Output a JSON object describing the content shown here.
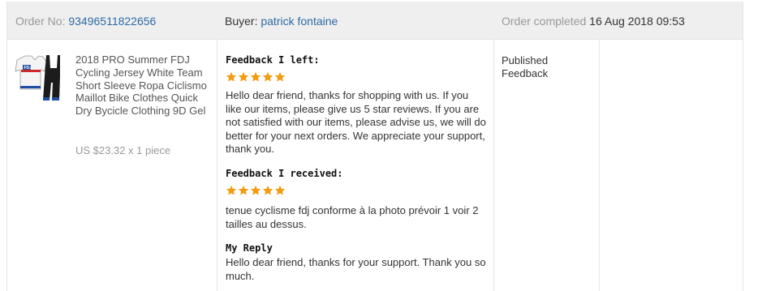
{
  "header": {
    "order_label": "Order No:",
    "order_number": "93496511822656",
    "buyer_label": "Buyer:",
    "buyer_name": "patrick fontaine",
    "completed_label": "Order completed",
    "completed_date": "16 Aug 2018 09:53"
  },
  "product": {
    "title": "2018 PRO Summer FDJ Cycling Jersey White Team Short Sleeve Ropa Ciclismo Maillot Bike Clothes Quick Dry Bycicle Clothing 9D Gel",
    "price": "US $23.32 x 1 piece",
    "thumb_icon": "cycling-kit-icon",
    "thumb_text": "FDJ"
  },
  "feedback_left": {
    "heading": "Feedback I left:",
    "stars": 5,
    "text": "Hello dear friend, thanks for shopping with us. If you like our items, please give us 5 star reviews. If you are not satisfied with our items, please advise us, we will do better for your next orders. We appreciate your support, thank you."
  },
  "feedback_received": {
    "heading": "Feedback I received:",
    "stars": 5,
    "text": "tenue cyclisme fdj conforme à la photo prévoir 1 voir 2 tailles au dessus."
  },
  "reply": {
    "heading": "My Reply",
    "text": "Hello dear friend, thanks for your support. Thank you so much."
  },
  "status": {
    "text": "Published Feedback"
  },
  "colors": {
    "link": "#2b6aa6",
    "star": "#f39c12",
    "header_bg": "#efefef"
  }
}
